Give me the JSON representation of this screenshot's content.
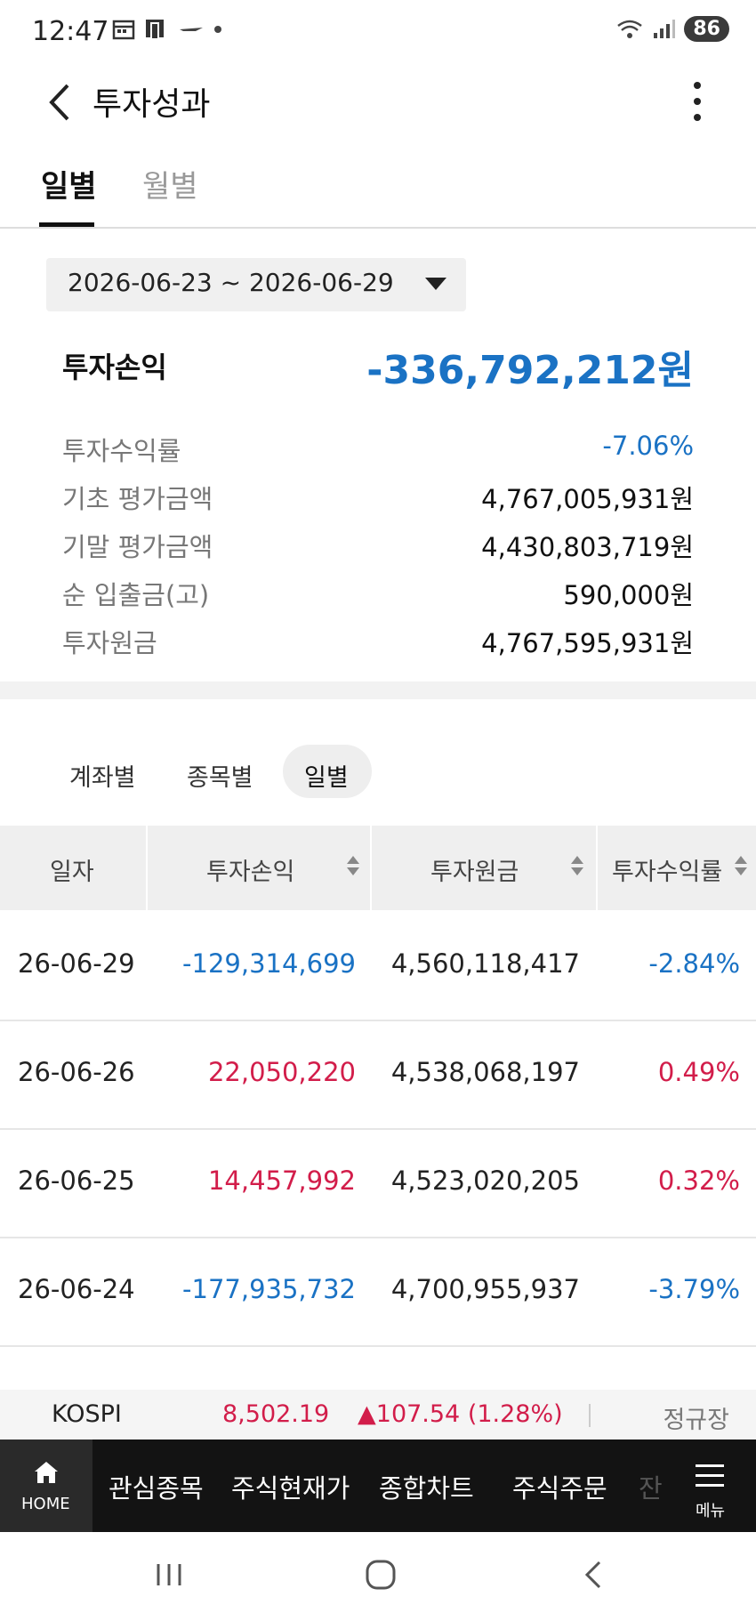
{
  "status_bar": {
    "time": "12:47",
    "battery": "86"
  },
  "header": {
    "title": "투자성과"
  },
  "tabs": [
    {
      "label": "일별"
    },
    {
      "label": "월별"
    }
  ],
  "date_range": "2026-06-23 ~ 2026-06-29",
  "summary": {
    "pnl_label": "투자손익",
    "pnl_value": "-336,792,212원",
    "rows": [
      {
        "label": "투자수익률",
        "value": "-7.06%"
      },
      {
        "label": "기초 평가금액",
        "value": "4,767,005,931원"
      },
      {
        "label": "기말 평가금액",
        "value": "4,430,803,719원"
      },
      {
        "label": "순 입출금(고)",
        "value": "590,000원"
      },
      {
        "label": "투자원금",
        "value": "4,767,595,931원"
      }
    ]
  },
  "sub_tabs": [
    {
      "label": "계좌별"
    },
    {
      "label": "종목별"
    },
    {
      "label": "일별"
    }
  ],
  "table": {
    "headers": [
      "일자",
      "투자손익",
      "투자원금",
      "투자수익률"
    ],
    "rows": [
      {
        "date": "26-06-29",
        "pnl": "-129,314,699",
        "principal": "4,560,118,417",
        "rate": "-2.84%"
      },
      {
        "date": "26-06-26",
        "pnl": "22,050,220",
        "principal": "4,538,068,197",
        "rate": "0.49%"
      },
      {
        "date": "26-06-25",
        "pnl": "14,457,992",
        "principal": "4,523,020,205",
        "rate": "0.32%"
      },
      {
        "date": "26-06-24",
        "pnl": "-177,935,732",
        "principal": "4,700,955,937",
        "rate": "-3.79%"
      }
    ]
  },
  "index_bar": {
    "name": "KOSPI",
    "value": "8,502.19",
    "change": "▲107.54 (1.28%)",
    "session": "정규장"
  },
  "bottom_nav": {
    "home_label": "HOME",
    "items": [
      "관심종목",
      "주식현재가",
      "종합차트",
      "주식주문",
      "잔"
    ],
    "menu_label": "메뉴"
  },
  "colors": {
    "negative": "#1a72c4",
    "positive": "#d21d4a"
  }
}
